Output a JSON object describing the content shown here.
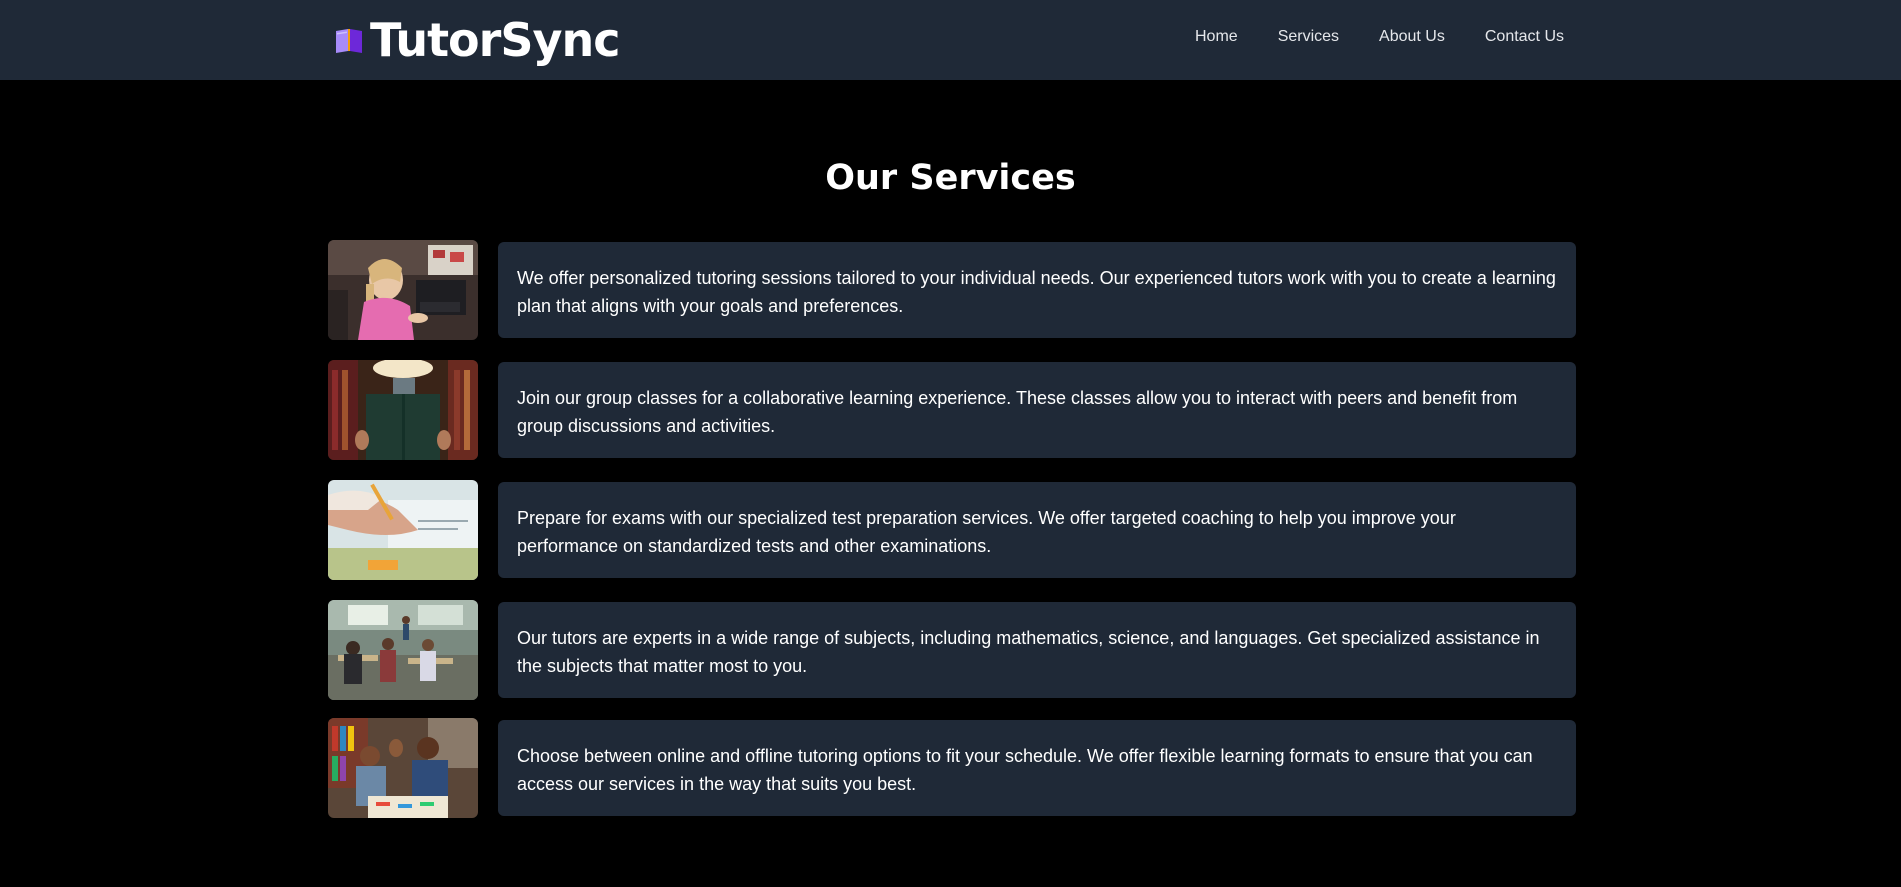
{
  "brand": {
    "name": "TutorSync",
    "icon": "book-icon"
  },
  "nav": {
    "items": [
      "Home",
      "Services",
      "About Us",
      "Contact Us"
    ]
  },
  "main": {
    "title": "Our Services",
    "services": [
      {
        "image": "girl-at-computer-photo",
        "text": "We offer personalized tutoring sessions tailored to your individual needs. Our experienced tutors work with you to create a learning plan that aligns with your goals and preferences."
      },
      {
        "image": "student-reading-in-library-photo",
        "text": "Join our group classes for a collaborative learning experience. These classes allow you to interact with peers and benefit from group discussions and activities."
      },
      {
        "image": "hand-writing-on-paper-photo",
        "text": "Prepare for exams with our specialized test preparation services. We offer targeted coaching to help you improve your performance on standardized tests and other examinations."
      },
      {
        "image": "classroom-photo",
        "text": "Our tutors are experts in a wide range of subjects, including mathematics, science, and languages. Get specialized assistance in the subjects that matter most to you."
      },
      {
        "image": "tutor-high-five-photo",
        "text": "Choose between online and offline tutoring options to fit your schedule. We offer flexible learning formats to ensure that you can access our services in the way that suits you best."
      }
    ]
  },
  "colors": {
    "header_bg": "#1f2937",
    "page_bg": "#000000",
    "card_bg": "#1f2937",
    "text": "#ffffff"
  }
}
